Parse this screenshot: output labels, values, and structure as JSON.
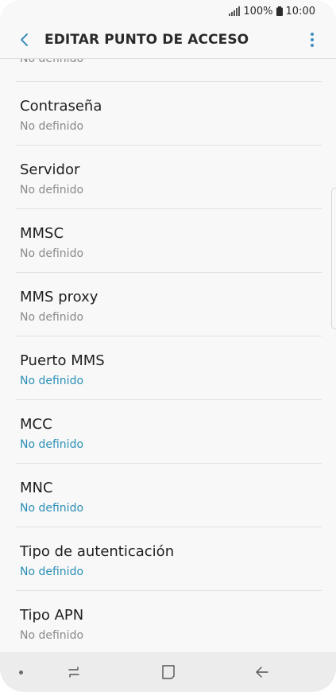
{
  "status_bar": {
    "battery": "100%",
    "time": "10:00"
  },
  "app_bar": {
    "title": "EDITAR PUNTO DE ACCESO",
    "back_icon": "chevron-left-icon",
    "menu_icon": "more-vertical-icon"
  },
  "list": {
    "partial_top_value": "No definido",
    "items": [
      {
        "label": "Contraseña",
        "value": "No definido",
        "value_style": "muted"
      },
      {
        "label": "Servidor",
        "value": "No definido",
        "value_style": "muted"
      },
      {
        "label": "MMSC",
        "value": "No definido",
        "value_style": "muted"
      },
      {
        "label": "MMS proxy",
        "value": "No definido",
        "value_style": "muted"
      },
      {
        "label": "Puerto MMS",
        "value": "No definido",
        "value_style": "accent"
      },
      {
        "label": "MCC",
        "value": "No definido",
        "value_style": "accent"
      },
      {
        "label": "MNC",
        "value": "No definido",
        "value_style": "accent"
      },
      {
        "label": "Tipo de autenticación",
        "value": "No definido",
        "value_style": "accent"
      },
      {
        "label": "Tipo APN",
        "value": "No definido",
        "value_style": "muted"
      }
    ]
  },
  "navigation": {
    "recents_icon": "recents-icon",
    "home_icon": "home-icon",
    "back_icon": "back-arrow-icon"
  },
  "colors": {
    "accent": "#2a8fb5",
    "muted": "#8a8a8a",
    "background": "#f8f8f8"
  }
}
